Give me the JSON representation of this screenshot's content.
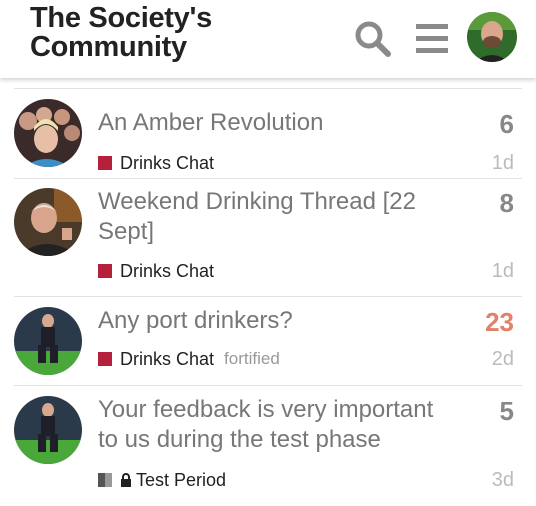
{
  "header": {
    "title_line1": "The Society's",
    "title_line2": "Community",
    "icons": [
      "search-icon",
      "menu-icon",
      "user-avatar"
    ]
  },
  "topics": [
    {
      "title": "An Amber Revolution",
      "category": "Drinks Chat",
      "category_color": "#b5213a",
      "tag": "",
      "posts": "6",
      "age": "1d"
    },
    {
      "title": "Weekend Drinking Thread [22 Sept]",
      "category": "Drinks Chat",
      "category_color": "#b5213a",
      "tag": "",
      "posts": "8",
      "age": "1d"
    },
    {
      "title": "Any port drinkers?",
      "category": "Drinks Chat",
      "category_color": "#b5213a",
      "tag": "fortified",
      "posts": "23",
      "age": "2d"
    },
    {
      "title": "Your feedback is very important to us during the test phase",
      "category": "Test Period",
      "category_color": "#555555",
      "tag": "",
      "posts": "5",
      "age": "3d"
    }
  ]
}
